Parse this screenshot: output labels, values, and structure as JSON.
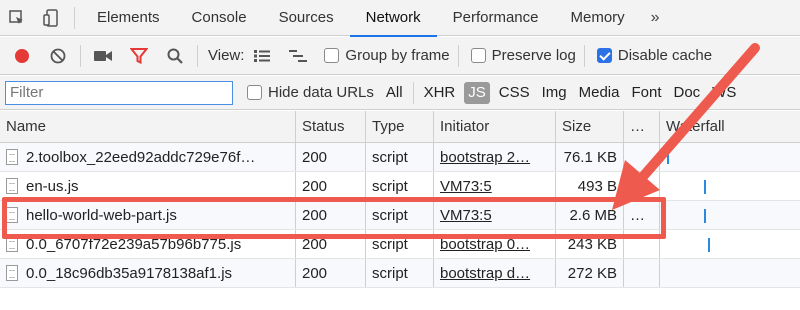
{
  "tabs": [
    "Elements",
    "Console",
    "Sources",
    "Network",
    "Performance",
    "Memory"
  ],
  "active_tab": "Network",
  "tabs_more": "»",
  "toolbar": {
    "view_label": "View:",
    "group_by_frame": "Group by frame",
    "preserve_log": "Preserve log",
    "disable_cache": "Disable cache"
  },
  "filter": {
    "placeholder": "Filter",
    "hide_data_urls": "Hide data URLs",
    "types": [
      "All",
      "XHR",
      "JS",
      "CSS",
      "Img",
      "Media",
      "Font",
      "Doc",
      "WS"
    ],
    "active_type": "JS"
  },
  "table": {
    "headers": {
      "name": "Name",
      "status": "Status",
      "type": "Type",
      "initiator": "Initiator",
      "size": "Size",
      "more": "…",
      "waterfall": "Waterfall"
    },
    "rows": [
      {
        "name": "2.toolbox_22eed92addc729e76f…",
        "status": "200",
        "type": "script",
        "initiator": "bootstrap 2…",
        "size": "76.1 KB",
        "more": ""
      },
      {
        "name": "en-us.js",
        "status": "200",
        "type": "script",
        "initiator": "VM73:5",
        "size": "493 B",
        "more": ""
      },
      {
        "name": "hello-world-web-part.js",
        "status": "200",
        "type": "script",
        "initiator": "VM73:5",
        "size": "2.6 MB",
        "more": "…"
      },
      {
        "name": "0.0_6707f72e239a57b96b775.js",
        "status": "200",
        "type": "script",
        "initiator": "bootstrap 0…",
        "size": "243 KB",
        "more": ""
      },
      {
        "name": "0.0_18c96db35a9178138af1.js",
        "status": "200",
        "type": "script",
        "initiator": "bootstrap d…",
        "size": "272 KB",
        "more": ""
      }
    ]
  },
  "colors": {
    "accent": "#1a73e8",
    "annotation": "#ef5a4e",
    "record": "#e53935"
  }
}
